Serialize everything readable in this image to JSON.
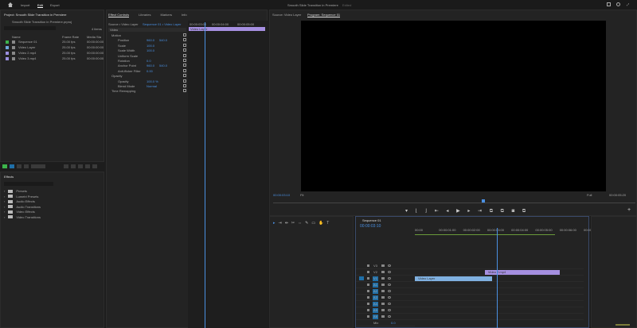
{
  "topbar": {
    "tabs": [
      "Import",
      "Edit",
      "Export"
    ],
    "active": "Edit",
    "title": "Smooth Slide Transition in Premiere",
    "status": "Edited"
  },
  "project": {
    "title": "Project: Smooth Slide Transition in Premiere",
    "path": "Smooth Slide Transition in Premiere.prproj",
    "items_count": "4 items",
    "columns": [
      "Name",
      "Frame Rate",
      "Media Sta"
    ],
    "rows": [
      {
        "name": "Sequence 01",
        "rate": "25.00 fps",
        "start": "00:00:00:00",
        "color": "#3cb44b"
      },
      {
        "name": "Video Layer",
        "rate": "25.00 fps",
        "start": "00:00:00:00",
        "color": "#6fa8dc"
      },
      {
        "name": "Video 2.mp4",
        "rate": "25.00 fps",
        "start": "00:00:00:00",
        "color": "#9b8fe0"
      },
      {
        "name": "Video 3.mp4",
        "rate": "25.00 fps",
        "start": "00:00:00:00",
        "color": "#9b8fe0"
      }
    ]
  },
  "effects": {
    "title": "Effects",
    "folders": [
      "Presets",
      "Lumetri Presets",
      "Audio Effects",
      "Audio Transitions",
      "Video Effects",
      "Video Transitions"
    ]
  },
  "effect_controls": {
    "tabs": [
      "Effect Controls",
      "Libraries",
      "Markers",
      "Info"
    ],
    "source": "Source • Video Layer",
    "sequence": "Sequence 01 • Video Layer",
    "section": "Video",
    "ruler": [
      "00:00:03:00",
      "00:00:04:00",
      "00:00:05:00"
    ],
    "clip": "Video Layer",
    "props": [
      {
        "name": "Motion",
        "v1": "",
        "v2": ""
      },
      {
        "name": "Position",
        "v1": "960.0",
        "v2": "540.0"
      },
      {
        "name": "Scale",
        "v1": "100.0",
        "v2": ""
      },
      {
        "name": "Scale Width",
        "v1": "100.0",
        "v2": ""
      },
      {
        "name": "Uniform Scale",
        "v1": "",
        "v2": ""
      },
      {
        "name": "Rotation",
        "v1": "0.0",
        "v2": ""
      },
      {
        "name": "Anchor Point",
        "v1": "960.0",
        "v2": "540.0"
      },
      {
        "name": "Anti-flicker Filter",
        "v1": "0.00",
        "v2": ""
      },
      {
        "name": "Opacity",
        "v1": "",
        "v2": ""
      },
      {
        "name": "Opacity",
        "v1": "100.0 %",
        "v2": ""
      },
      {
        "name": "Blend Mode",
        "v1": "Normal",
        "v2": ""
      },
      {
        "name": "Time Remapping",
        "v1": "",
        "v2": ""
      }
    ]
  },
  "program": {
    "source_tab": "Source: Video Layer",
    "tab": "Program: Sequence 01",
    "timecode": "00:00:03:10",
    "fit": "Fit",
    "quality": "Full",
    "duration": "00:00:05:20"
  },
  "timeline": {
    "title": "Sequence 01",
    "timecode": "00:00:03:10",
    "ruler": [
      "00:00",
      "00:00:01:00",
      "00:00:02:00",
      "00:00:03:00",
      "00:00:04:00",
      "00:00:05:00",
      "00:00:06:00",
      "00:00"
    ],
    "video_tracks": [
      "V3",
      "V2",
      "V1"
    ],
    "audio_tracks": [
      "A1",
      "A2",
      "A3",
      "A4",
      "A5",
      "A6"
    ],
    "mix": "Mix",
    "mix_value": "0.0",
    "clips": [
      {
        "name": "Video Layer",
        "track": "V1",
        "start": 0,
        "end": 3.2,
        "color": "#7fb0e0"
      },
      {
        "name": "Video 2.mp4",
        "track": "V2",
        "start": 2.9,
        "end": 6.0,
        "color": "#a58fe0"
      }
    ],
    "playhead": 3.4,
    "max": 7
  },
  "tools": [
    "Selection",
    "Track Select",
    "Ripple Edit",
    "Razor",
    "Slip",
    "Pen",
    "Rectangle",
    "Hand",
    "Type"
  ]
}
